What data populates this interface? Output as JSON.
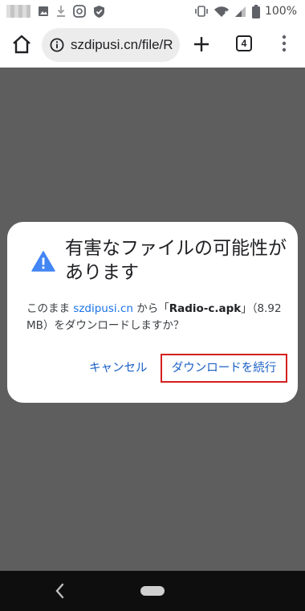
{
  "status_bar": {
    "left_icons": [
      "blurred-notification",
      "image-icon",
      "download-icon",
      "app-icon",
      "shield-icon"
    ],
    "right_icons": [
      "vibrate-icon",
      "wifi-icon",
      "signal-icon",
      "battery-icon"
    ],
    "battery": "100%"
  },
  "toolbar": {
    "url": "szdipusi.cn/file/R",
    "tab_count": "4"
  },
  "dialog": {
    "title": "有害なファイルの可能性があります",
    "body_prefix": "このまま ",
    "site": "szdipusi.cn",
    "body_middle": " から「",
    "filename": "Radio-c.apk",
    "body_suffix": "」（8.92 MB）をダウンロードしますか？",
    "cancel_label": "キャンセル",
    "continue_label": "ダウンロードを続行"
  },
  "colors": {
    "accent": "#1a73e8",
    "highlight_border": "#d5201f",
    "dim_overlay": "#5e5e5e",
    "warning_icon": "#4285f4"
  }
}
